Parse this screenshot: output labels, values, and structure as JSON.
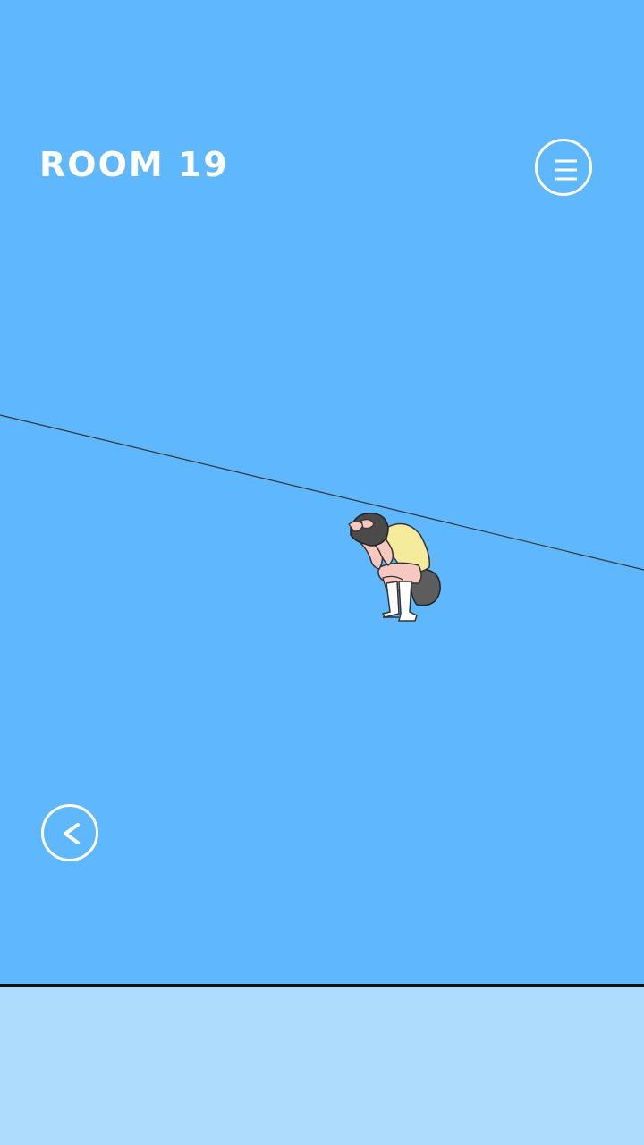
{
  "header": {
    "room_label": "ROOM 19"
  },
  "buttons": {
    "menu_icon": "hamburger-menu-icon",
    "back_icon": "chevron-left-icon"
  },
  "colors": {
    "sky": "#5fb8fd",
    "floor_panel": "#aedcfd",
    "ui_stroke": "#ffffff",
    "rope": "#333333"
  }
}
